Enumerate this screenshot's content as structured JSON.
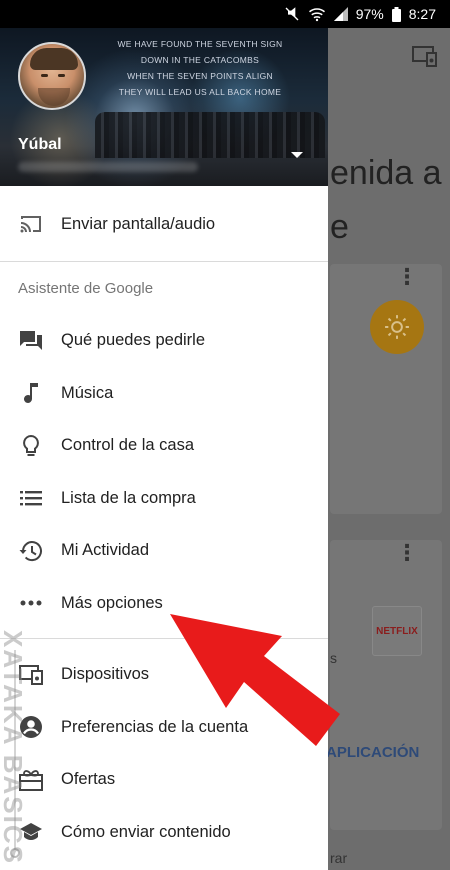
{
  "status_bar": {
    "battery": "97%",
    "time": "8:27",
    "icons": [
      "mute-icon",
      "wifi-icon",
      "signal-icon",
      "battery-icon"
    ]
  },
  "background_app": {
    "welcome_text": "enida a\ne",
    "card2_text": "s",
    "app_link": "APLICACIÓN",
    "netflix_logo": "NETFLIX",
    "footer_text": "rar"
  },
  "drawer": {
    "header": {
      "username": "Yúbal",
      "lyrics": [
        "WE HAVE FOUND THE SEVENTH SIGN",
        "DOWN IN THE CATACOMBS",
        "WHEN THE SEVEN POINTS ALIGN",
        "THEY WILL LEAD US ALL BACK HOME"
      ]
    },
    "cast_item": {
      "label": "Enviar pantalla/audio",
      "icon": "cast-icon"
    },
    "assistant_section": {
      "title": "Asistente de Google",
      "items": [
        {
          "label": "Qué puedes pedirle",
          "icon": "chat-icon"
        },
        {
          "label": "Música",
          "icon": "music-note-icon"
        },
        {
          "label": "Control de la casa",
          "icon": "lightbulb-icon"
        },
        {
          "label": "Lista de la compra",
          "icon": "list-icon"
        },
        {
          "label": "Mi Actividad",
          "icon": "history-icon"
        },
        {
          "label": "Más opciones",
          "icon": "more-horiz-icon"
        }
      ]
    },
    "bottom_items": [
      {
        "label": "Dispositivos",
        "icon": "devices-icon"
      },
      {
        "label": "Preferencias de la cuenta",
        "icon": "account-circle-icon"
      },
      {
        "label": "Ofertas",
        "icon": "gift-icon"
      },
      {
        "label": "Cómo enviar contenido",
        "icon": "school-icon"
      }
    ]
  },
  "watermark": {
    "text": "XATAKA BASICS"
  },
  "colors": {
    "arrow": "#e81b1b",
    "accent_bg": "#a67612"
  }
}
